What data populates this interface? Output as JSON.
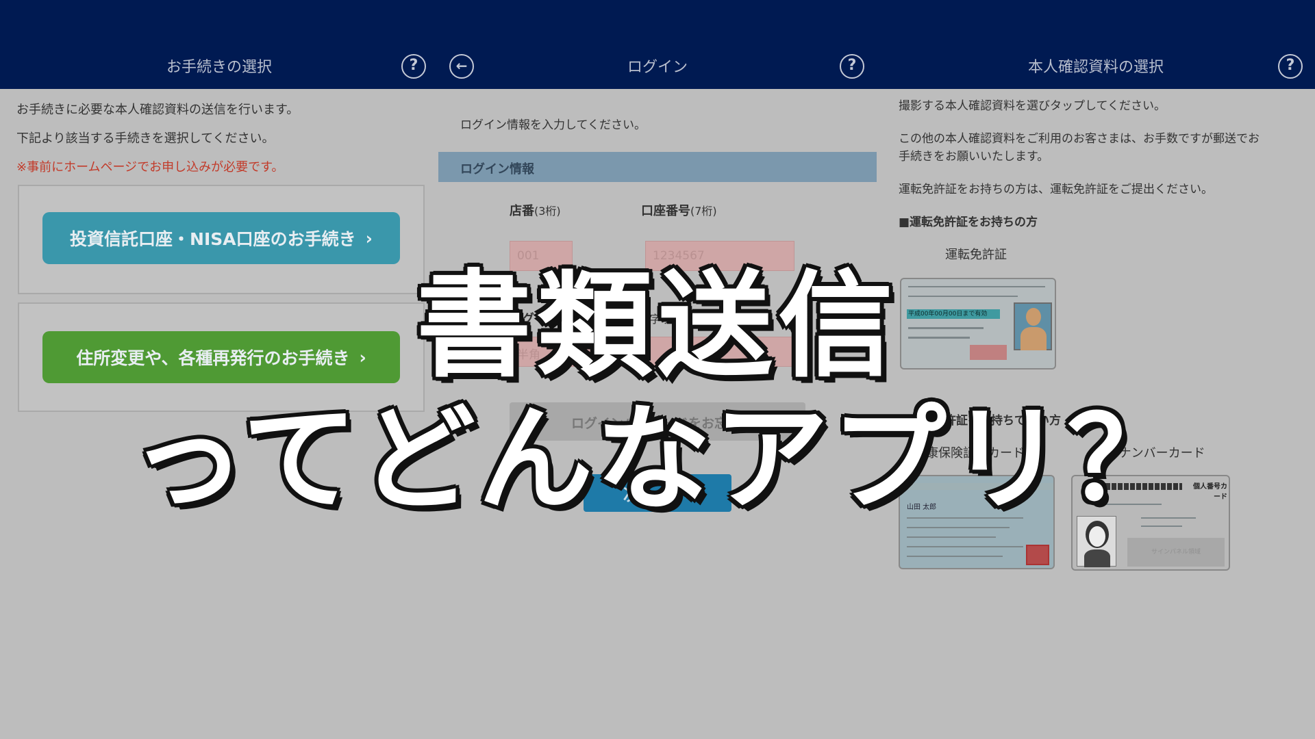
{
  "panel1": {
    "header_title": "お手続きの選択",
    "help_glyph": "?",
    "line1": "お手続きに必要な本人確認資料の送信を行います。",
    "line2": "下記より該当する手続きを選択してください。",
    "notice": "※事前にホームページでお申し込みが必要です。",
    "button1": "投資信託口座・NISA口座のお手続き",
    "button2": "住所変更や、各種再発行のお手続き",
    "chevron": "›"
  },
  "panel2": {
    "back_glyph": "←",
    "header_title": "ログイン",
    "help_glyph": "?",
    "instruction": "ログイン情報を入力してください。",
    "section_title": "ログイン情報",
    "store_label": "店番",
    "store_hint": "(3桁)",
    "account_label": "口座番号",
    "account_hint": "(7桁)",
    "store_value": "001",
    "account_value": "1234567",
    "password_label": "ログインパスワード",
    "password_hint": "(32文字以内)",
    "password_placeholder": "半角",
    "forgot_label": "ログインパスワードをお忘れの方",
    "forgot_plus": "＋",
    "next_label": "次へ",
    "next_chevron": "›"
  },
  "panel3": {
    "header_title": "本人確認資料の選択",
    "help_glyph": "?",
    "line1": "撮影する本人確認資料を選びタップしてください。",
    "line2a": "この他の本人確認資料をご利用のお客さまは、お手数ですが郵送でお",
    "line2b": "手続きをお願いいたします。",
    "line3": "運転免許証をお持ちの方は、運転免許証をご提出ください。",
    "section1": "■運転免許証をお持ちの方",
    "card1_label": "運転免許証",
    "card1_validity": "平成00年00月00日まで有効",
    "section2": "■運転免許証をお持ちでない方",
    "card2_label": "健康保険証（カード）",
    "card3_label": "マイナンバーカード",
    "card2_name": "山田 太郎",
    "card3_title": "個人番号カード",
    "card3_sign": "サインパネル領域"
  },
  "overlay": {
    "line1": "書類送信",
    "line2": "ってどんなアプリ？"
  },
  "colors": {
    "header": "#001a52",
    "teal_button": "#3a97ab",
    "green_button": "#4f9a34",
    "next_button": "#1e7aa8",
    "notice_red": "#c23b2a"
  }
}
